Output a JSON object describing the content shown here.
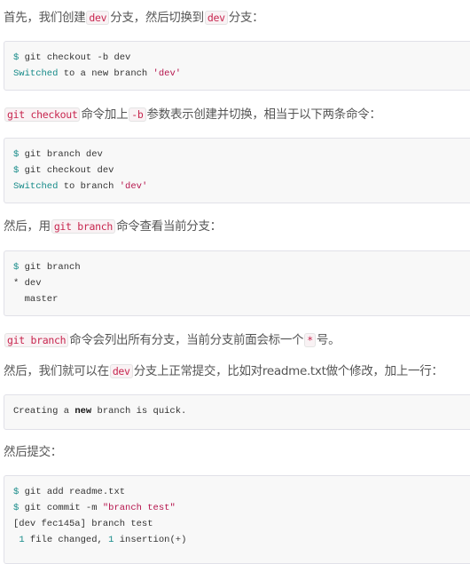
{
  "p1": {
    "a": "首先，我们创建",
    "c1": "dev",
    "b": "分支，然后切换到",
    "c2": "dev",
    "d": "分支："
  },
  "code1": {
    "l1": "git checkout -b dev",
    "l2a": "Switched",
    "l2b": " to a new branch ",
    "l2c": "'dev'"
  },
  "p2": {
    "c1": "git checkout",
    "a": "命令加上",
    "c2": "-b",
    "b": "参数表示创建并切换，相当于以下两条命令："
  },
  "code2": {
    "l1": "git branch dev",
    "l2": "git checkout dev",
    "l3a": "Switched",
    "l3b": " to branch ",
    "l3c": "'dev'"
  },
  "p3": {
    "a": "然后，用",
    "c1": "git branch",
    "b": "命令查看当前分支："
  },
  "code3": {
    "l1": "git branch",
    "l2": "* dev",
    "l3": "  master"
  },
  "p4": {
    "c1": "git branch",
    "a": "命令会列出所有分支，当前分支前面会标一个",
    "c2": "*",
    "b": "号。"
  },
  "p5": {
    "a": "然后，我们就可以在",
    "c1": "dev",
    "b": "分支上正常提交，比如对readme.txt做个修改，加上一行："
  },
  "code4": {
    "a": "Creating a ",
    "b": "new",
    "c": " branch is quick."
  },
  "p6": {
    "a": "然后提交："
  },
  "code5": {
    "l1": "git add readme.txt",
    "l2a": "git commit -m ",
    "l2b": "\"branch test\"",
    "l3": "[dev fec145a] branch test",
    "l4a": "1",
    "l4b": " file changed, ",
    "l4c": "1",
    "l4d": " insertion(+)"
  },
  "prompt": "$"
}
